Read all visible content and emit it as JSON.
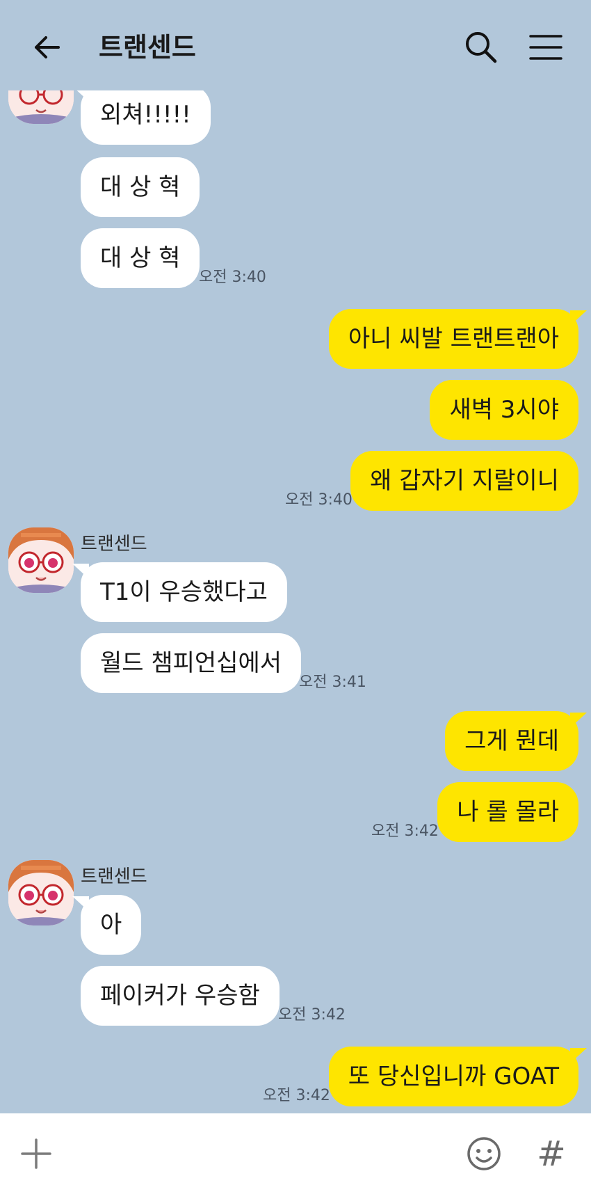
{
  "header": {
    "title": "트랜센드",
    "back_icon": "arrow-left-icon",
    "search_icon": "search-icon",
    "menu_icon": "hamburger-menu-icon"
  },
  "messages": [
    {
      "text": "외쳐!!!!!"
    },
    {
      "text": "대 상 혁"
    },
    {
      "text": "대 상 혁"
    },
    {
      "time": "오전 3:40"
    },
    {
      "text": "아니 씨발 트랜트랜아"
    },
    {
      "text": "새벽 3시야"
    },
    {
      "text": "왜 갑자기 지랄이니"
    },
    {
      "time": "오전 3:40"
    },
    {
      "sender": "트랜센드"
    },
    {
      "text": "T1이 우승했다고"
    },
    {
      "text": "월드 챔피언십에서"
    },
    {
      "time": "오전 3:41"
    },
    {
      "text": "그게 뭔데"
    },
    {
      "text": "나 롤 몰라"
    },
    {
      "time": "오전 3:42"
    },
    {
      "sender": "트랜센드"
    },
    {
      "text": "아"
    },
    {
      "text": "페이커가 우승함"
    },
    {
      "time": "오전 3:42"
    },
    {
      "text": "또 당신입니까 GOAT"
    },
    {
      "time": "오전 3:42"
    }
  ],
  "input_bar": {
    "plus_icon": "plus-icon",
    "emoji_icon": "emoji-icon",
    "hash_label": "#"
  },
  "colors": {
    "background": "#b2c7da",
    "incoming_bubble": "#ffffff",
    "outgoing_bubble": "#fee500"
  }
}
